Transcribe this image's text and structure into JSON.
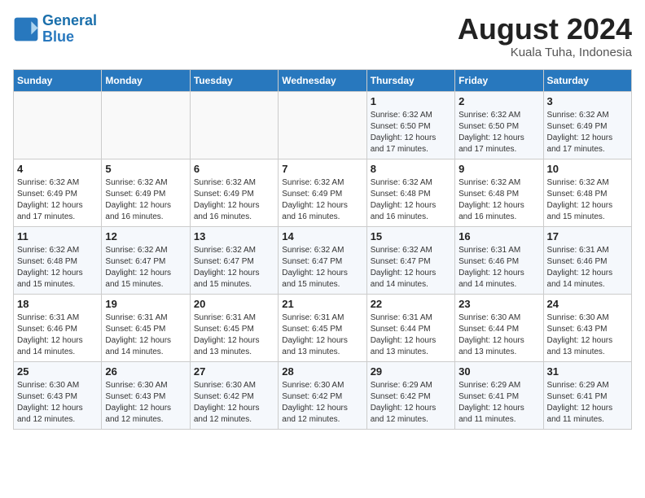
{
  "header": {
    "logo_line1": "General",
    "logo_line2": "Blue",
    "month_year": "August 2024",
    "location": "Kuala Tuha, Indonesia"
  },
  "weekdays": [
    "Sunday",
    "Monday",
    "Tuesday",
    "Wednesday",
    "Thursday",
    "Friday",
    "Saturday"
  ],
  "weeks": [
    [
      {
        "day": "",
        "info": ""
      },
      {
        "day": "",
        "info": ""
      },
      {
        "day": "",
        "info": ""
      },
      {
        "day": "",
        "info": ""
      },
      {
        "day": "1",
        "info": "Sunrise: 6:32 AM\nSunset: 6:50 PM\nDaylight: 12 hours\nand 17 minutes."
      },
      {
        "day": "2",
        "info": "Sunrise: 6:32 AM\nSunset: 6:50 PM\nDaylight: 12 hours\nand 17 minutes."
      },
      {
        "day": "3",
        "info": "Sunrise: 6:32 AM\nSunset: 6:49 PM\nDaylight: 12 hours\nand 17 minutes."
      }
    ],
    [
      {
        "day": "4",
        "info": "Sunrise: 6:32 AM\nSunset: 6:49 PM\nDaylight: 12 hours\nand 17 minutes."
      },
      {
        "day": "5",
        "info": "Sunrise: 6:32 AM\nSunset: 6:49 PM\nDaylight: 12 hours\nand 16 minutes."
      },
      {
        "day": "6",
        "info": "Sunrise: 6:32 AM\nSunset: 6:49 PM\nDaylight: 12 hours\nand 16 minutes."
      },
      {
        "day": "7",
        "info": "Sunrise: 6:32 AM\nSunset: 6:49 PM\nDaylight: 12 hours\nand 16 minutes."
      },
      {
        "day": "8",
        "info": "Sunrise: 6:32 AM\nSunset: 6:48 PM\nDaylight: 12 hours\nand 16 minutes."
      },
      {
        "day": "9",
        "info": "Sunrise: 6:32 AM\nSunset: 6:48 PM\nDaylight: 12 hours\nand 16 minutes."
      },
      {
        "day": "10",
        "info": "Sunrise: 6:32 AM\nSunset: 6:48 PM\nDaylight: 12 hours\nand 15 minutes."
      }
    ],
    [
      {
        "day": "11",
        "info": "Sunrise: 6:32 AM\nSunset: 6:48 PM\nDaylight: 12 hours\nand 15 minutes."
      },
      {
        "day": "12",
        "info": "Sunrise: 6:32 AM\nSunset: 6:47 PM\nDaylight: 12 hours\nand 15 minutes."
      },
      {
        "day": "13",
        "info": "Sunrise: 6:32 AM\nSunset: 6:47 PM\nDaylight: 12 hours\nand 15 minutes."
      },
      {
        "day": "14",
        "info": "Sunrise: 6:32 AM\nSunset: 6:47 PM\nDaylight: 12 hours\nand 15 minutes."
      },
      {
        "day": "15",
        "info": "Sunrise: 6:32 AM\nSunset: 6:47 PM\nDaylight: 12 hours\nand 14 minutes."
      },
      {
        "day": "16",
        "info": "Sunrise: 6:31 AM\nSunset: 6:46 PM\nDaylight: 12 hours\nand 14 minutes."
      },
      {
        "day": "17",
        "info": "Sunrise: 6:31 AM\nSunset: 6:46 PM\nDaylight: 12 hours\nand 14 minutes."
      }
    ],
    [
      {
        "day": "18",
        "info": "Sunrise: 6:31 AM\nSunset: 6:46 PM\nDaylight: 12 hours\nand 14 minutes."
      },
      {
        "day": "19",
        "info": "Sunrise: 6:31 AM\nSunset: 6:45 PM\nDaylight: 12 hours\nand 14 minutes."
      },
      {
        "day": "20",
        "info": "Sunrise: 6:31 AM\nSunset: 6:45 PM\nDaylight: 12 hours\nand 13 minutes."
      },
      {
        "day": "21",
        "info": "Sunrise: 6:31 AM\nSunset: 6:45 PM\nDaylight: 12 hours\nand 13 minutes."
      },
      {
        "day": "22",
        "info": "Sunrise: 6:31 AM\nSunset: 6:44 PM\nDaylight: 12 hours\nand 13 minutes."
      },
      {
        "day": "23",
        "info": "Sunrise: 6:30 AM\nSunset: 6:44 PM\nDaylight: 12 hours\nand 13 minutes."
      },
      {
        "day": "24",
        "info": "Sunrise: 6:30 AM\nSunset: 6:43 PM\nDaylight: 12 hours\nand 13 minutes."
      }
    ],
    [
      {
        "day": "25",
        "info": "Sunrise: 6:30 AM\nSunset: 6:43 PM\nDaylight: 12 hours\nand 12 minutes."
      },
      {
        "day": "26",
        "info": "Sunrise: 6:30 AM\nSunset: 6:43 PM\nDaylight: 12 hours\nand 12 minutes."
      },
      {
        "day": "27",
        "info": "Sunrise: 6:30 AM\nSunset: 6:42 PM\nDaylight: 12 hours\nand 12 minutes."
      },
      {
        "day": "28",
        "info": "Sunrise: 6:30 AM\nSunset: 6:42 PM\nDaylight: 12 hours\nand 12 minutes."
      },
      {
        "day": "29",
        "info": "Sunrise: 6:29 AM\nSunset: 6:42 PM\nDaylight: 12 hours\nand 12 minutes."
      },
      {
        "day": "30",
        "info": "Sunrise: 6:29 AM\nSunset: 6:41 PM\nDaylight: 12 hours\nand 11 minutes."
      },
      {
        "day": "31",
        "info": "Sunrise: 6:29 AM\nSunset: 6:41 PM\nDaylight: 12 hours\nand 11 minutes."
      }
    ]
  ]
}
